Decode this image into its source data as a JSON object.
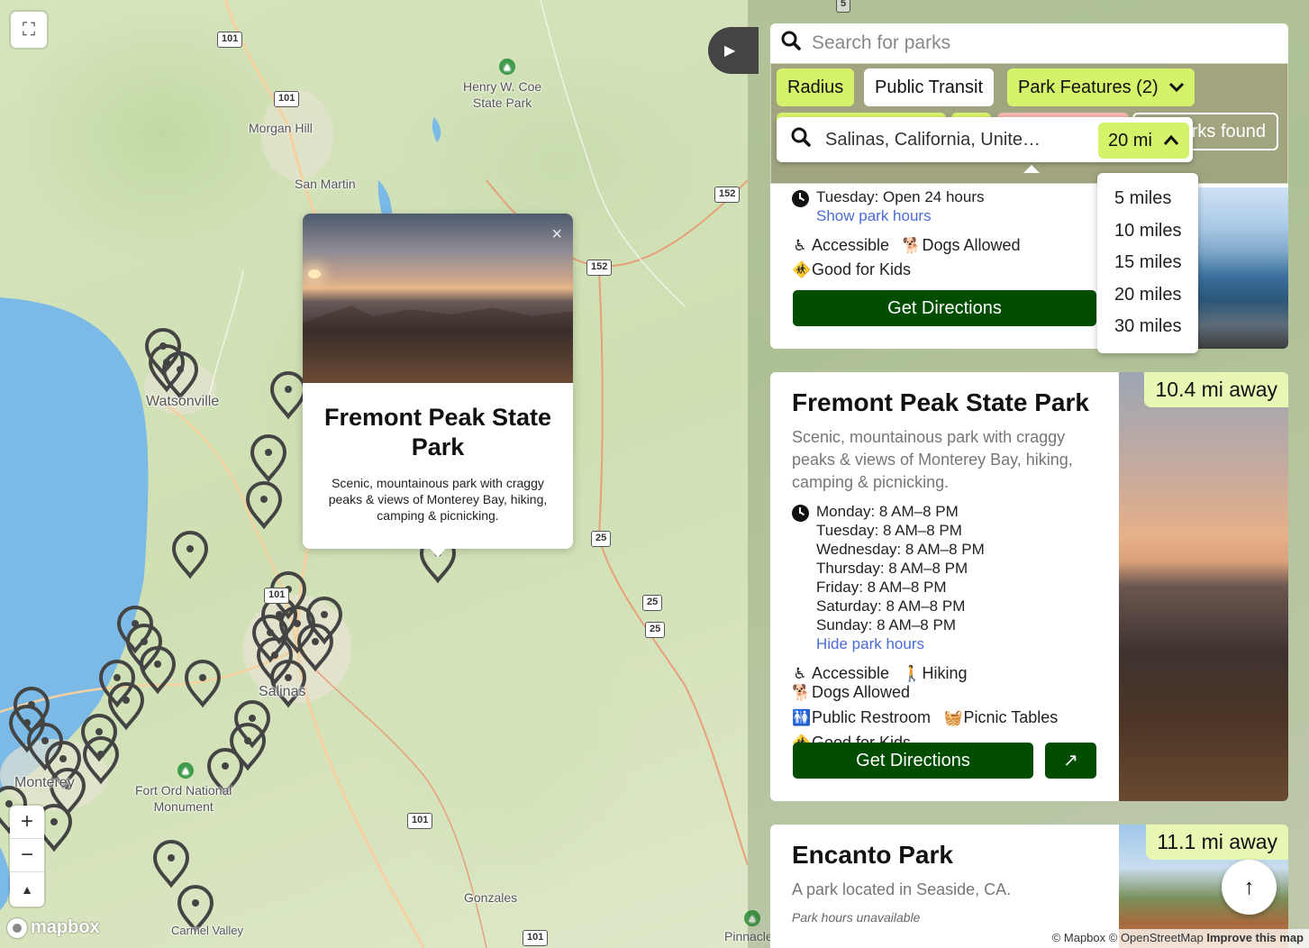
{
  "map": {
    "labels": {
      "henry_coe": "Henry W. Coe\nState Park",
      "morgan_hill": "Morgan Hill",
      "san_martin": "San Martin",
      "watsonville": "Watsonville",
      "salinas": "Salinas",
      "fort_ord": "Fort Ord National\nMonument",
      "monterey": "Monterey",
      "gonzales": "Gonzales",
      "carmel_valley": "Carmel Valley",
      "pinnacles": "Pinnacles"
    },
    "highways": {
      "h101a": "101",
      "h101b": "101",
      "h101c": "101",
      "h101d": "101",
      "h101e": "101",
      "h152a": "152",
      "h152b": "152",
      "h25a": "25",
      "h25b": "25",
      "h25c": "25",
      "h5": "5"
    },
    "attribution": "© Mapbox © OpenStreetMap",
    "improve": "Improve this map",
    "logo": "mapbox",
    "zoom_in": "+",
    "zoom_out": "−",
    "compass": "▲",
    "fullscreen": "⛶",
    "collapse": "▶"
  },
  "popup": {
    "title": "Fremont Peak State Park",
    "description": "Scenic, mountainous park with craggy peaks & views of Monterey Bay, hiking, camping & picnicking.",
    "close": "×"
  },
  "search": {
    "placeholder": "Search for parks"
  },
  "filters": {
    "radius": "Radius",
    "transit": "Public Transit",
    "features": "Park Features (2)",
    "found": "rks found"
  },
  "location": {
    "value": "Salinas, California, Unite…",
    "radius_selected": "20 mi",
    "options": [
      "5 miles",
      "10 miles",
      "15 miles",
      "20 miles",
      "30 miles"
    ]
  },
  "card1": {
    "hours_line": "Tuesday: Open 24 hours",
    "show_hours": "Show park hours",
    "features": [
      "Accessible",
      "Dogs Allowed",
      "Good for Kids"
    ],
    "directions": "Get Directions"
  },
  "card2": {
    "distance": "10.4 mi away",
    "title": "Fremont Peak State Park",
    "description": "Scenic, mountainous park with craggy peaks & views of Monterey Bay, hiking, camping & picnicking.",
    "hours": [
      "Monday: 8 AM–8 PM",
      "Tuesday: 8 AM–8 PM",
      "Wednesday: 8 AM–8 PM",
      "Thursday: 8 AM–8 PM",
      "Friday: 8 AM–8 PM",
      "Saturday: 8 AM–8 PM",
      "Sunday: 8 AM–8 PM"
    ],
    "hide_hours": "Hide park hours",
    "features": [
      "Accessible",
      "Hiking",
      "Dogs Allowed",
      "Public Restroom",
      "Picnic Tables",
      "Good for Kids"
    ],
    "directions": "Get Directions",
    "external": "↗"
  },
  "card3": {
    "distance": "11.1 mi away",
    "title": "Encanto Park",
    "description": "A park located in Seaside, CA.",
    "hours_unavailable": "Park hours unavailable"
  },
  "scroll_top": "↑"
}
